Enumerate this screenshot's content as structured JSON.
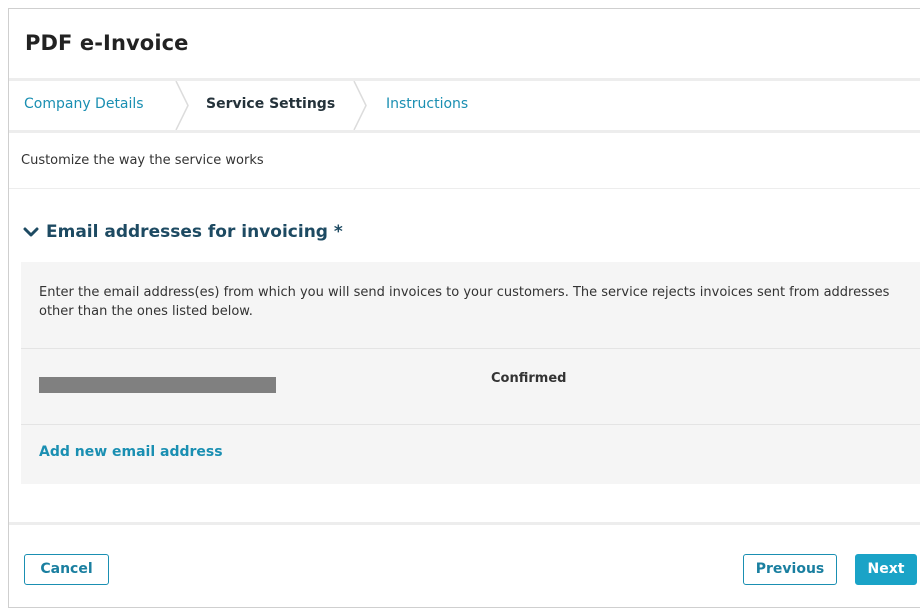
{
  "dialog": {
    "title": "PDF e-Invoice"
  },
  "steps": [
    {
      "label": "Company Details",
      "state": "done"
    },
    {
      "label": "Service Settings",
      "state": "active"
    },
    {
      "label": "Instructions",
      "state": "pending"
    }
  ],
  "subtitle": "Customize the way the service works",
  "section": {
    "title": "Email addresses for invoicing *",
    "icon": "chevron-down-icon",
    "description": "Enter the email address(es) from which you will send invoices to your customers. The service rejects invoices sent from addresses other than the ones listed below.",
    "emails": [
      {
        "address_redacted": true,
        "status": "Confirmed"
      }
    ],
    "add_label": "Add new email address"
  },
  "footer": {
    "cancel_label": "Cancel",
    "previous_label": "Previous",
    "next_label": "Next"
  },
  "colors": {
    "accent": "#1aa3c7",
    "link": "#1a8fb2",
    "section_title": "#1d4a62",
    "panel_bg": "#f5f5f5",
    "redaction": "#808080"
  }
}
